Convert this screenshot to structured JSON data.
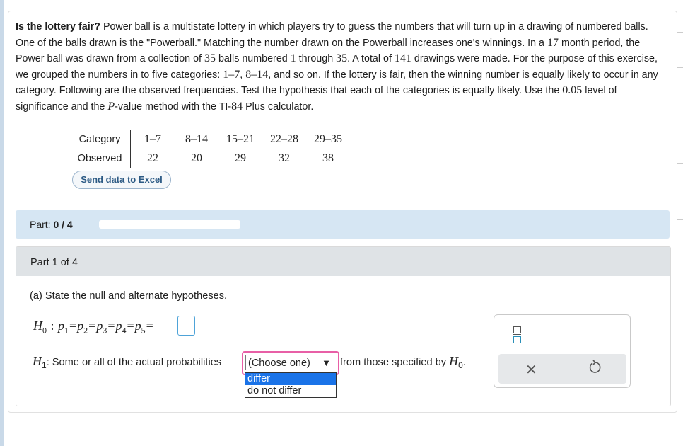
{
  "problem": {
    "title": "Is the lottery fair?",
    "text_1": " Power ball is a multistate lottery in which players try to guess the numbers that will turn up in a drawing of numbered balls. One of the balls drawn is the \"Powerball.\" Matching the number drawn on the Powerball increases one's winnings. In a ",
    "months": "17",
    "text_2": " month period, the Power ball was drawn from a collection of ",
    "balls": "35",
    "text_3": " balls numbered ",
    "low": "1",
    "text_4": " through ",
    "high": "35",
    "text_5": ". A total of ",
    "drawings": "141",
    "text_6": " drawings were made. For the purpose of this exercise, we grouped the numbers in to five categories: ",
    "cat_a": "1–7",
    "text_7": ", ",
    "cat_b": "8–14",
    "text_8": ", and so on. If the lottery is fair, then the winning number is equally likely to occur in any category. Following are the observed frequencies. Test the hypothesis that each of the categories is equally likely. Use the ",
    "alpha": "0.05",
    "text_9": " level of significance and the ",
    "pvar": "P",
    "text_10": "-value method with the TI-",
    "ti": "84",
    "text_11": " Plus calculator."
  },
  "table": {
    "row_label_1": "Category",
    "row_label_2": "Observed",
    "categories": [
      "1–7",
      "8–14",
      "15–21",
      "22–28",
      "29–35"
    ],
    "observed": [
      "22",
      "20",
      "29",
      "32",
      "38"
    ]
  },
  "excel_button": "Send data to Excel",
  "progress": {
    "label": "Part: ",
    "value": "0 / 4",
    "fraction": 0
  },
  "part": {
    "header": "Part 1 of 4",
    "question": "(a) State the null and alternate hypotheses."
  },
  "h0": {
    "label": "H",
    "sub": "0",
    "colon": " : ",
    "p": "p",
    "subs": [
      "1",
      "2",
      "3",
      "4",
      "5"
    ],
    "eq": "="
  },
  "h1": {
    "label": "H",
    "sub": "1",
    "text_before": ": Some or all of the actual probabilities",
    "select_value": "(Choose one)",
    "text_after": " from those specified by ",
    "h0_label": "H",
    "h0_sub": "0",
    "period": "."
  },
  "dropdown": {
    "options": [
      "differ",
      "do not differ"
    ],
    "highlighted": "differ"
  },
  "tool_icons": {
    "fraction": "fraction-icon",
    "clear": "close-icon",
    "undo": "undo-icon"
  },
  "colors": {
    "accent": "#1a73e8",
    "select_border": "#e85fa6",
    "progress_bg": "#d6e6f3"
  }
}
